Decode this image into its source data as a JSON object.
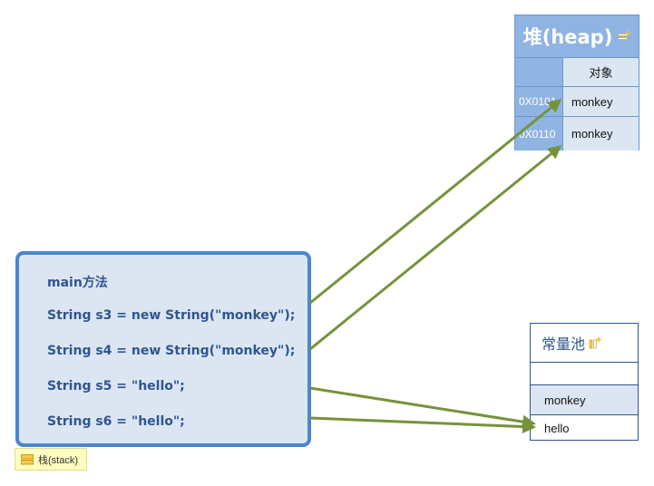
{
  "stack": {
    "lines": [
      "main方法",
      "String s3 = new String(\"monkey\");",
      "String s4 = new String(\"monkey\");",
      "String s5 = \"hello\";",
      "String s6 = \"hello\";"
    ],
    "tag_label": "栈(stack)",
    "tag_icon": "stack-icon"
  },
  "heap": {
    "title": "堆(heap)",
    "title_icon": "add-node-icon",
    "column_header": "对象",
    "rows": [
      {
        "address": "0X0101",
        "value": "monkey"
      },
      {
        "address": "0X0110",
        "value": "monkey"
      }
    ]
  },
  "pool": {
    "title": "常量池",
    "title_icon": "add-node-icon",
    "rows": [
      "",
      "monkey",
      "hello"
    ]
  },
  "colors": {
    "stack_border": "#4a86cd",
    "stack_fill": "#dce6f3",
    "heap_header": "#8fb4e2",
    "arrow": "#76923c",
    "text_blue": "#2f568f"
  }
}
